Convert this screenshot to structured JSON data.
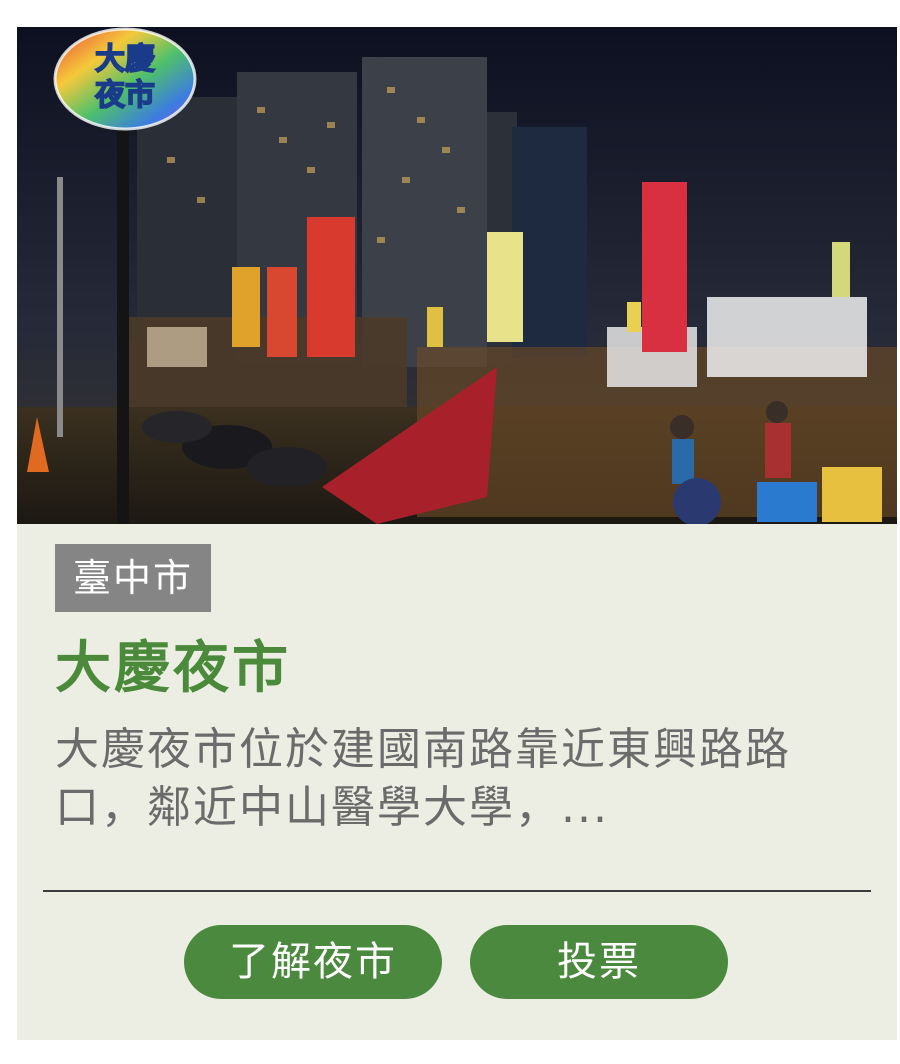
{
  "card": {
    "photo_alt": "大慶夜市",
    "sign_text_line1": "大慶",
    "sign_text_line2": "夜市",
    "region": "臺中市",
    "title": "大慶夜市",
    "description": "大慶夜市位於建國南路靠近東興路路口，鄰近中山醫學大學，...",
    "buttons": {
      "learn_more": "了解夜市",
      "vote": "投票"
    }
  },
  "colors": {
    "title_green": "#4a8a3a",
    "button_green": "#4b8a3e",
    "badge_gray": "#858585",
    "card_bg": "#eceee4",
    "description_gray": "#6b6b6b"
  }
}
